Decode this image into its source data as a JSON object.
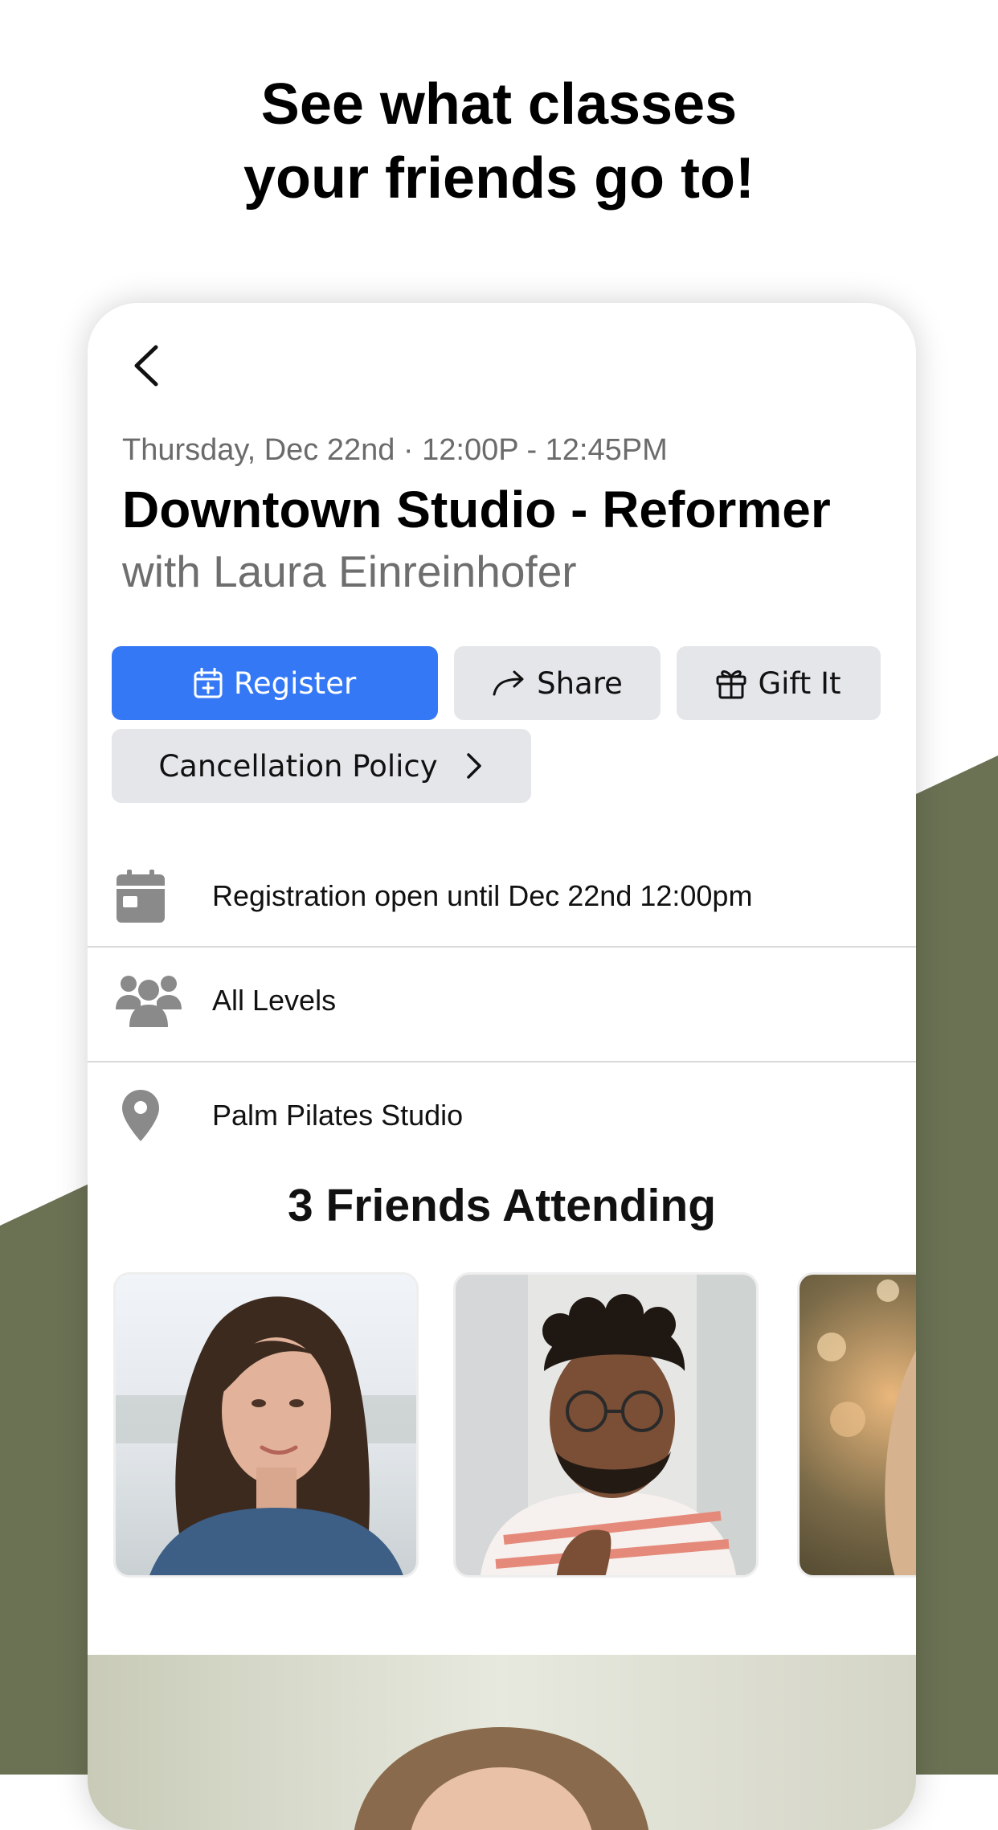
{
  "headline": {
    "line1": "See what classes",
    "line2": "your friends go to!"
  },
  "colors": {
    "accent": "#3478f6",
    "olive_background": "#6b7254",
    "secondary_button": "#e4e6ea"
  },
  "class": {
    "datetime": "Thursday, Dec 22nd · 12:00P - 12:45PM",
    "title": "Downtown Studio - Reformer",
    "instructor": "with Laura Einreinhofer"
  },
  "actions": {
    "register_label": "Register",
    "share_label": "Share",
    "gift_label": "Gift It",
    "cancellation_label": "Cancellation Policy"
  },
  "details": [
    {
      "icon": "calendar-icon",
      "text": "Registration open until Dec 22nd 12:00pm"
    },
    {
      "icon": "group-icon",
      "text": "All Levels"
    },
    {
      "icon": "location-pin-icon",
      "text": "Palm Pilates Studio"
    }
  ],
  "friends": {
    "title": "3 Friends Attending"
  }
}
